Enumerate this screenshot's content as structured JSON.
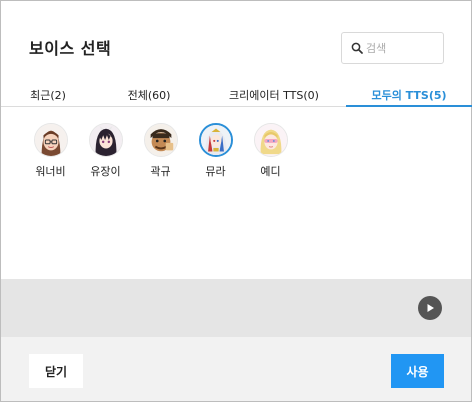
{
  "dialog": {
    "title": "보이스 선택"
  },
  "search": {
    "placeholder": "검색",
    "value": ""
  },
  "tabs": [
    {
      "label": "최근(2)",
      "active": false
    },
    {
      "label": "전체(60)",
      "active": false
    },
    {
      "label": "크리에이터 TTS(0)",
      "active": false
    },
    {
      "label": "모두의 TTS(5)",
      "active": true
    }
  ],
  "voices": [
    {
      "name": "워너비",
      "avatar_icon": "girl-avatar-icon",
      "selected": false
    },
    {
      "name": "유장이",
      "avatar_icon": "dark-hair-girl-avatar-icon",
      "selected": false
    },
    {
      "name": "곽규",
      "avatar_icon": "man-avatar-icon",
      "selected": false
    },
    {
      "name": "뮤라",
      "avatar_icon": "robot-girl-avatar-icon",
      "selected": true
    },
    {
      "name": "예디",
      "avatar_icon": "blonde-girl-avatar-icon",
      "selected": false
    }
  ],
  "player": {
    "play_icon": "play-icon"
  },
  "footer": {
    "close_label": "닫기",
    "use_label": "사용"
  },
  "colors": {
    "accent": "#2a8fd8",
    "primary_button": "#2196f3",
    "player_bg": "#e5e5e5",
    "footer_bg": "#f2f2f2"
  }
}
